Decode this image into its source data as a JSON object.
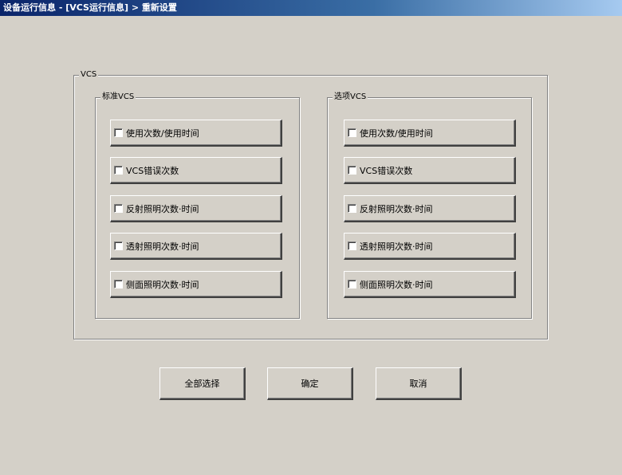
{
  "window": {
    "title": "设备运行信息 - [VCS运行信息] > 重新设置"
  },
  "vcs_group": {
    "legend": "VCS"
  },
  "standard_group": {
    "legend": "标准VCS",
    "items": [
      {
        "label": "使用次数/使用时间",
        "checked": false
      },
      {
        "label": "VCS错误次数",
        "checked": false
      },
      {
        "label": "反射照明次数·时间",
        "checked": false
      },
      {
        "label": "透射照明次数·时间",
        "checked": false
      },
      {
        "label": "侧面照明次数·时间",
        "checked": false
      }
    ]
  },
  "option_group": {
    "legend": "选项VCS",
    "items": [
      {
        "label": "使用次数/使用时间",
        "checked": false
      },
      {
        "label": "VCS错误次数",
        "checked": false
      },
      {
        "label": "反射照明次数·时间",
        "checked": false
      },
      {
        "label": "透射照明次数·时间",
        "checked": false
      },
      {
        "label": "侧面照明次数·时间",
        "checked": false
      }
    ]
  },
  "buttons": {
    "select_all": "全部选择",
    "ok": "确定",
    "cancel": "取消"
  },
  "colors": {
    "background": "#d4d0c8",
    "titlebar_start": "#0a246a",
    "titlebar_end": "#a6caf0"
  }
}
